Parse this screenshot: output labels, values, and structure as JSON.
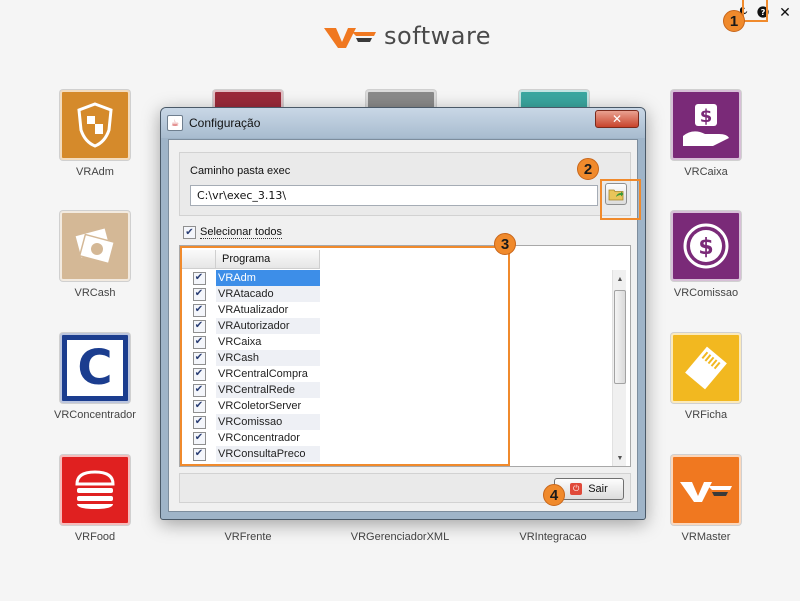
{
  "brand": {
    "name": "software"
  },
  "top_bar": {
    "settings_icon": "wrench-icon",
    "help_icon": "help-icon",
    "close_icon": "close-icon"
  },
  "markers": [
    "1",
    "2",
    "3",
    "4"
  ],
  "apps": [
    {
      "label": "VRAdm",
      "color": "#d58a2b",
      "icon": "shield-icon"
    },
    {
      "label": "VRCash",
      "color": "#d4b896",
      "icon": "cash-icon"
    },
    {
      "label": "VRConcentrador",
      "color": "#1b3d8f",
      "icon": "c-letter-icon"
    },
    {
      "label": "VRFood",
      "color": "#e02020",
      "icon": "burger-icon"
    },
    {
      "label": "VRFrente",
      "color": "#9b2a3a",
      "icon": "register-icon"
    },
    {
      "label": "VRGerenciadorXML",
      "color": "#e08a30",
      "icon": "xml-icon"
    },
    {
      "label": "VRIntegracao",
      "color": "#3aa7a0",
      "icon": "integration-icon"
    },
    {
      "label": "VRCaixa",
      "color": "#7a2a78",
      "icon": "money-hand-icon"
    },
    {
      "label": "VRComissao",
      "color": "#7a2a78",
      "icon": "dollar-coin-icon"
    },
    {
      "label": "VRFicha",
      "color": "#f2b820",
      "icon": "ticket-icon"
    },
    {
      "label": "VRMaster",
      "color": "#f07820",
      "icon": "vr-logo-icon"
    }
  ],
  "dialog": {
    "title": "Configuração",
    "close_label": "✕",
    "path_label": "Caminho pasta exec",
    "path_value": "C:\\vr\\exec_3.13\\",
    "select_all_label": "Selecionar todos",
    "select_all_checked": true,
    "table_header": "Programa",
    "programs": [
      {
        "name": "VRAdm",
        "checked": true,
        "selected": true
      },
      {
        "name": "VRAtacado",
        "checked": true
      },
      {
        "name": "VRAtualizador",
        "checked": true
      },
      {
        "name": "VRAutorizador",
        "checked": true
      },
      {
        "name": "VRCaixa",
        "checked": true
      },
      {
        "name": "VRCash",
        "checked": true
      },
      {
        "name": "VRCentralCompra",
        "checked": true
      },
      {
        "name": "VRCentralRede",
        "checked": true
      },
      {
        "name": "VRColetorServer",
        "checked": true
      },
      {
        "name": "VRComissao",
        "checked": true
      },
      {
        "name": "VRConcentrador",
        "checked": true
      },
      {
        "name": "VRConsultaPreco",
        "checked": true
      }
    ],
    "exit_label": "Sair"
  }
}
